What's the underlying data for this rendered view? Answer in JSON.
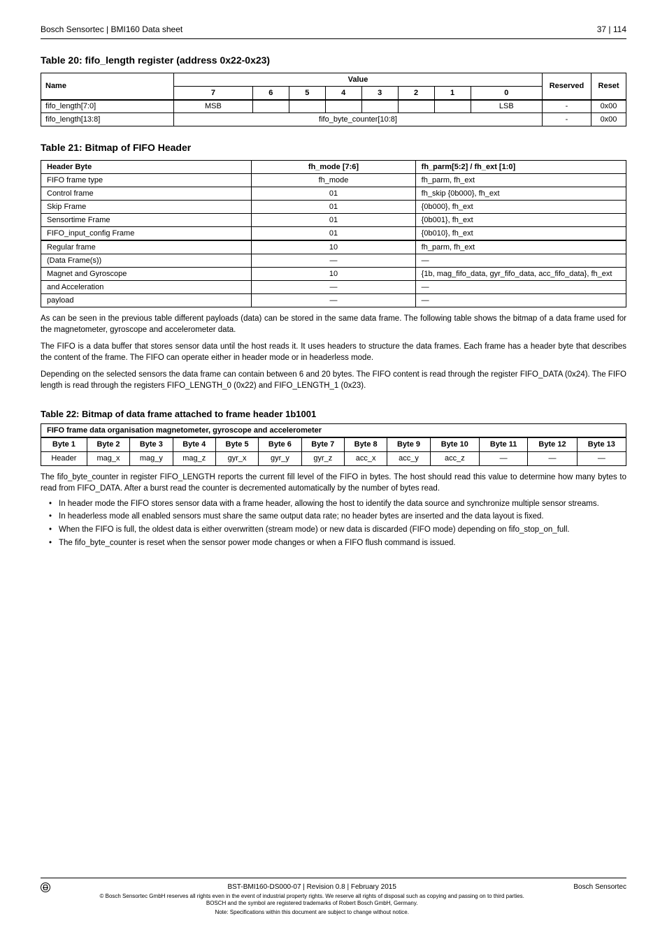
{
  "header": {
    "left": "Bosch Sensortec | BMI160 Data sheet",
    "right": "37 | 114"
  },
  "sections": {
    "s20": {
      "title": "Table 20: fifo_length register (address 0x22-0x23)",
      "headers": {
        "name": "Name",
        "value": "Value",
        "reserved": "Reserved",
        "reset": "Reset"
      },
      "bits": [
        "7",
        "6",
        "5",
        "4",
        "3",
        "2",
        "1",
        "0"
      ],
      "rows": [
        {
          "name": "fifo_length[7:0]",
          "cells": [
            "MSB",
            "",
            "",
            "",
            "",
            "",
            "",
            "LSB"
          ],
          "reserved": "-",
          "reset": "0x00"
        },
        {
          "name": "fifo_length[13:8]",
          "merged_label": "fifo_byte_counter[10:8]",
          "reserved": "-",
          "reset": "0x00"
        }
      ]
    },
    "s21": {
      "title": "Table 21: Bitmap of FIFO Header",
      "headers": [
        "Header Byte",
        "fh_mode [7:6]",
        "fh_parm[5:2] / fh_ext [1:0]"
      ],
      "rows": [
        [
          "FIFO frame type",
          "fh_mode",
          "fh_parm, fh_ext"
        ],
        [
          "Control frame",
          "01",
          "fh_skip {0b000}, fh_ext"
        ],
        [
          "Skip Frame",
          "01",
          "{0b000}, fh_ext"
        ],
        [
          "Sensortime Frame",
          "01",
          "{0b001}, fh_ext"
        ],
        [
          "FIFO_input_config Frame",
          "01",
          "{0b010}, fh_ext"
        ]
      ],
      "thick_rows": [
        [
          "Regular frame",
          "10",
          "fh_parm, fh_ext"
        ],
        [
          "(Data Frame(s))",
          "—",
          "—"
        ],
        [
          "Magnet and Gyroscope",
          "10",
          "{1b, mag_fifo_data, gyr_fifo_data, acc_fifo_data}, fh_ext"
        ],
        [
          "and Acceleration",
          "—",
          "—"
        ],
        [
          "payload",
          "—",
          "—"
        ]
      ],
      "note": "As can be seen in the previous table different payloads (data) can be stored in the same data frame. The following table shows the bitmap of a data frame used for the magnetometer, gyroscope and accelerometer data."
    },
    "s22": {
      "title": "Table 22: Bitmap of data frame attached to frame header 1b1001",
      "caption": "FIFO frame data organisation magnetometer, gyroscope and accelerometer",
      "row1": [
        "Byte 1",
        "Byte 2",
        "Byte 3",
        "Byte 4",
        "Byte 5",
        "Byte 6",
        "Byte 7",
        "Byte 8",
        "Byte 9",
        "Byte 10",
        "Byte 11",
        "Byte 12",
        "Byte 13"
      ],
      "row2": [
        "Header",
        "mag_x",
        "mag_y",
        "mag_z",
        "gyr_x",
        "gyr_y",
        "gyr_z",
        "acc_x",
        "acc_y",
        "acc_z",
        "—",
        "—",
        "—"
      ]
    },
    "text": {
      "p1": "The FIFO is a data buffer that stores sensor data until the host reads it. It uses headers to structure the data frames. Each frame has a header byte that describes the content of the frame. The FIFO can operate either in header mode or in headerless mode.",
      "p2": "Depending on the selected sensors the data frame can contain between 6 and 20 bytes. The FIFO content is read through the register FIFO_DATA (0x24). The FIFO length is read through the registers FIFO_LENGTH_0 (0x22) and FIFO_LENGTH_1 (0x23).",
      "list": [
        "In header mode the FIFO stores sensor data with a frame header, allowing the host to identify the data source and synchronize multiple sensor streams.",
        "In headerless mode all enabled sensors must share the same output data rate; no header bytes are inserted and the data layout is fixed.",
        "When the FIFO is full, the oldest data is either overwritten (stream mode) or new data is discarded (FIFO mode) depending on fifo_stop_on_full.",
        "The fifo_byte_counter is reset when the sensor power mode changes or when a FIFO flush command is issued."
      ],
      "p3": "The fifo_byte_counter in register FIFO_LENGTH reports the current fill level of the FIFO in bytes. The host should read this value to determine how many bytes to read from FIFO_DATA. After a burst read the counter is decremented automatically by the number of bytes read."
    }
  },
  "footer": {
    "doc": "BST-BMI160-DS000-07 | Revision 0.8 | February 2015",
    "company": "Bosch Sensortec",
    "copyright": "© Bosch Sensortec GmbH reserves all rights even in the event of industrial property rights. We reserve all rights of disposal such as copying and passing on to third parties. BOSCH and the symbol are registered trademarks of Robert Bosch GmbH, Germany.",
    "note": "Note: Specifications within this document are subject to change without notice."
  }
}
